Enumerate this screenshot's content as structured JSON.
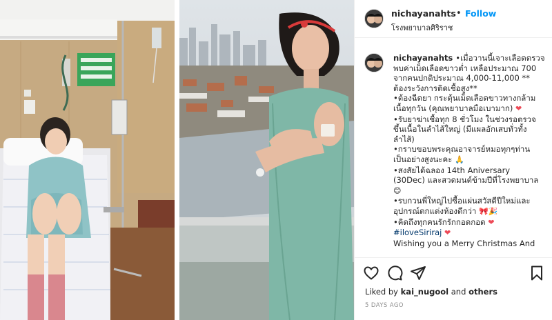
{
  "post": {
    "username": "nichayanahts",
    "dot": "•",
    "follow_label": "Follow",
    "location": "โรงพยาบาลศิริราช"
  },
  "caption": {
    "username": "nichayanahts",
    "lines": [
      "•เมื่อวานนี้เจาะเลือดตรวจ",
      "พบค่าเม็ดเลือดขาวต่ำ เหลือประมาณ 700",
      "จากคนปกติประมาณ 4,000-11,000 **",
      "ต้องระวังการติดเชื้อสูง**",
      "•ต้องฉีดยา กระตุ้นเม็ดเลือดขาวทางกล้าม",
      "เนื้อทุกวัน (คุณพยาบาลมือเบามาก)",
      "•รับยาฆ่าเชื้อทุก 8 ชั่วโมง ในช่วงรอตรวจ",
      "ขึ้นเนื้อในลำไส้ใหญ่ (มีแผลอักเสบทั่วทั้ง",
      "ลำไส้)",
      "•กราบขอบพระคุณอาจารย์หมอทุกๆท่าน",
      "เป็นอย่างสูงนะคะ",
      "•สงสัยได้ฉลอง 14th Aniversary",
      "(30Dec) และสวดมนต์ข้ามปีที่โรงพยาบาล",
      "",
      "•รบกวนพี่ใหญ่ไปซื้อแผ่นสวัสดีปีใหม่และ",
      "อุปกรณ์ตกแต่งห้องดีกว่า",
      "•คิดถึงทุกคนรักรักกอดกอด",
      "#iloveSiriraj",
      "Wishing you a Merry Christmas And"
    ]
  },
  "actions": {
    "liked_prefix": "Liked by ",
    "liked_user": "kai_nugool",
    "liked_and": " and ",
    "liked_others": "others",
    "time": "5 DAYS AGO"
  },
  "icons": [
    "like-icon",
    "comment-icon",
    "share-icon",
    "save-icon",
    "heart-emoji",
    "pray-emoji",
    "smile-emoji",
    "bow-emoji",
    "party-emoji"
  ],
  "colors": {
    "link": "#0095f6",
    "hashtag": "#00376b",
    "heart": "#ed4956",
    "muted": "#8e8e8e"
  }
}
